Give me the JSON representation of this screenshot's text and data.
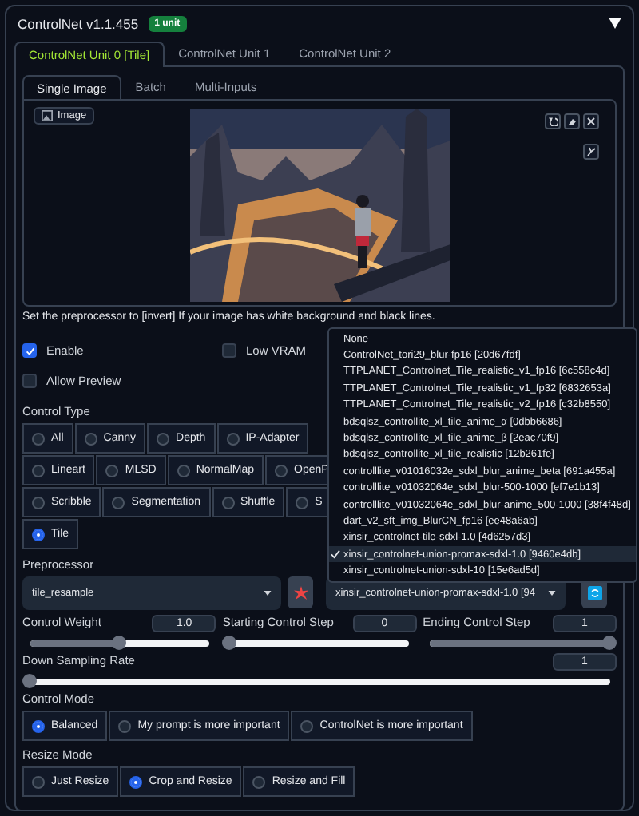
{
  "header": {
    "title": "ControlNet v1.1.455",
    "badge": "1 unit",
    "expanded": true
  },
  "unit_tabs": [
    {
      "label": "ControlNet Unit 0 [Tile]",
      "selected": true
    },
    {
      "label": "ControlNet Unit 1",
      "selected": false
    },
    {
      "label": "ControlNet Unit 2",
      "selected": false
    }
  ],
  "input_tabs": [
    {
      "label": "Single Image",
      "selected": true
    },
    {
      "label": "Batch",
      "selected": false
    },
    {
      "label": "Multi-Inputs",
      "selected": false
    }
  ],
  "image_panel": {
    "label": "Image"
  },
  "note": "Set the preprocessor to [invert] If your image has white background and black lines.",
  "options": [
    {
      "label": "Enable",
      "checked": true
    },
    {
      "label": "Low VRAM",
      "checked": false
    },
    {
      "label": "Allow Preview",
      "checked": false
    }
  ],
  "control_type": {
    "label": "Control Type",
    "rows": [
      [
        {
          "label": "All",
          "selected": false
        },
        {
          "label": "Canny",
          "selected": false
        },
        {
          "label": "Depth",
          "selected": false
        },
        {
          "label": "IP-Adapter",
          "selected": false
        }
      ],
      [
        {
          "label": "Lineart",
          "selected": false
        },
        {
          "label": "MLSD",
          "selected": false
        },
        {
          "label": "NormalMap",
          "selected": false
        },
        {
          "label": "OpenP",
          "selected": false
        }
      ],
      [
        {
          "label": "Scribble",
          "selected": false
        },
        {
          "label": "Segmentation",
          "selected": false
        },
        {
          "label": "Shuffle",
          "selected": false
        },
        {
          "label": "S",
          "selected": false
        }
      ],
      [
        {
          "label": "Tile",
          "selected": true
        }
      ]
    ]
  },
  "preprocessor": {
    "label": "Preprocessor",
    "value": "tile_resample"
  },
  "model": {
    "value": "xinsir_controlnet-union-promax-sdxl-1.0 [94"
  },
  "model_dropdown": {
    "options": [
      {
        "label": "None",
        "selected": false
      },
      {
        "label": "ControlNet_tori29_blur-fp16 [20d67fdf]",
        "selected": false
      },
      {
        "label": "TTPLANET_Controlnet_Tile_realistic_v1_fp16 [6c558c4d]",
        "selected": false
      },
      {
        "label": "TTPLANET_Controlnet_Tile_realistic_v1_fp32 [6832653a]",
        "selected": false
      },
      {
        "label": "TTPLANET_Controlnet_Tile_realistic_v2_fp16 [c32b8550]",
        "selected": false
      },
      {
        "label": "bdsqlsz_controllite_xl_tile_anime_α [0dbb6686]",
        "selected": false
      },
      {
        "label": "bdsqlsz_controllite_xl_tile_anime_β [2eac70f9]",
        "selected": false
      },
      {
        "label": "bdsqlsz_controllite_xl_tile_realistic [12b261fe]",
        "selected": false
      },
      {
        "label": "controlllite_v01016032e_sdxl_blur_anime_beta [691a455a]",
        "selected": false
      },
      {
        "label": "controlllite_v01032064e_sdxl_blur-500-1000 [ef7e1b13]",
        "selected": false
      },
      {
        "label": "controlllite_v01032064e_sdxl_blur-anime_500-1000 [38f4f48d]",
        "selected": false
      },
      {
        "label": "dart_v2_sft_img_BlurCN_fp16 [ee48a6ab]",
        "selected": false
      },
      {
        "label": "xinsir_controlnet-tile-sdxl-1.0 [4d6257d3]",
        "selected": false
      },
      {
        "label": "xinsir_controlnet-union-promax-sdxl-1.0 [9460e4db]",
        "selected": true
      },
      {
        "label": "xinsir_controlnet-union-sdxl-10 [15e6ad5d]",
        "selected": false
      }
    ]
  },
  "sliders": [
    {
      "label": "Control Weight",
      "value": "1.0",
      "level": 0.5
    },
    {
      "label": "Starting Control Step",
      "value": "0",
      "level": 0
    },
    {
      "label": "Ending Control Step",
      "value": "1",
      "level": 1
    },
    {
      "label": "Down Sampling Rate",
      "value": "1",
      "level": 0
    }
  ],
  "control_mode": {
    "label": "Control Mode",
    "options": [
      {
        "label": "Balanced",
        "selected": true
      },
      {
        "label": "My prompt is more important",
        "selected": false
      },
      {
        "label": "ControlNet is more important",
        "selected": false
      }
    ]
  },
  "resize_mode": {
    "label": "Resize Mode",
    "options": [
      {
        "label": "Just Resize",
        "selected": false
      },
      {
        "label": "Crop and Resize",
        "selected": true
      },
      {
        "label": "Resize and Fill",
        "selected": false
      }
    ]
  }
}
